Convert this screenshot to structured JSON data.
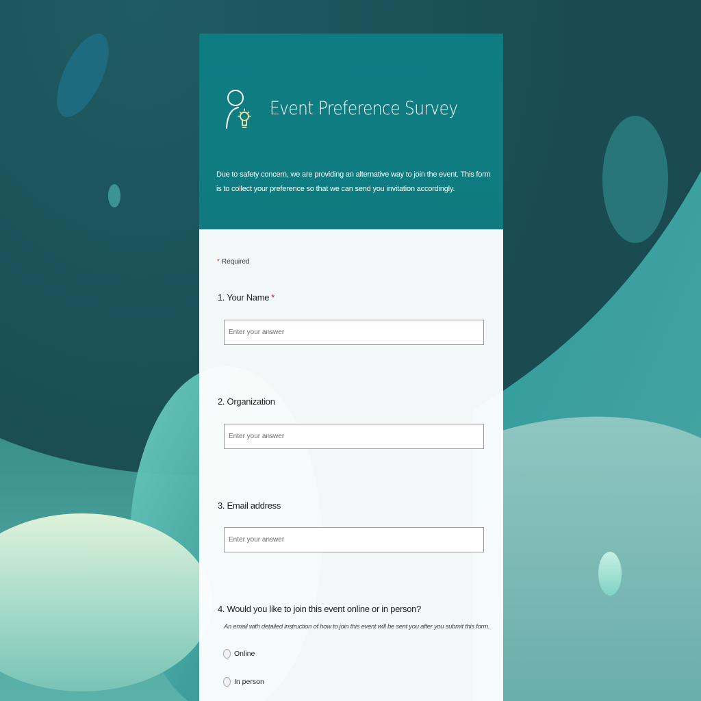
{
  "colors": {
    "header_bg": "#0e7c80",
    "page_bg": "#1a4b52",
    "required_star": "#a4262c",
    "logo_accent": "#f2e6a6"
  },
  "icons": {
    "logo": "person-lightbulb-icon",
    "radio": "radio-button-icon"
  },
  "form": {
    "title": "Event Preference Survey",
    "description": "Due to safety concern, we are providing an alternative way to join the event. This form is to collect your preference so that we can send you invitation accordingly.",
    "required_note": "Required",
    "required_star": "*",
    "questions": [
      {
        "label": "1. Your Name",
        "required_star": "*",
        "placeholder": "Enter your answer"
      },
      {
        "label": "2. Organization",
        "placeholder": "Enter your answer"
      },
      {
        "label": "3. Email address",
        "placeholder": "Enter your answer"
      },
      {
        "label": "4. Would you like to join this event online or in person?",
        "subtitle": "An email with detailed instruction of how to join this event will be sent you after you submit this form.",
        "options": [
          "Online",
          "In person"
        ]
      }
    ]
  }
}
